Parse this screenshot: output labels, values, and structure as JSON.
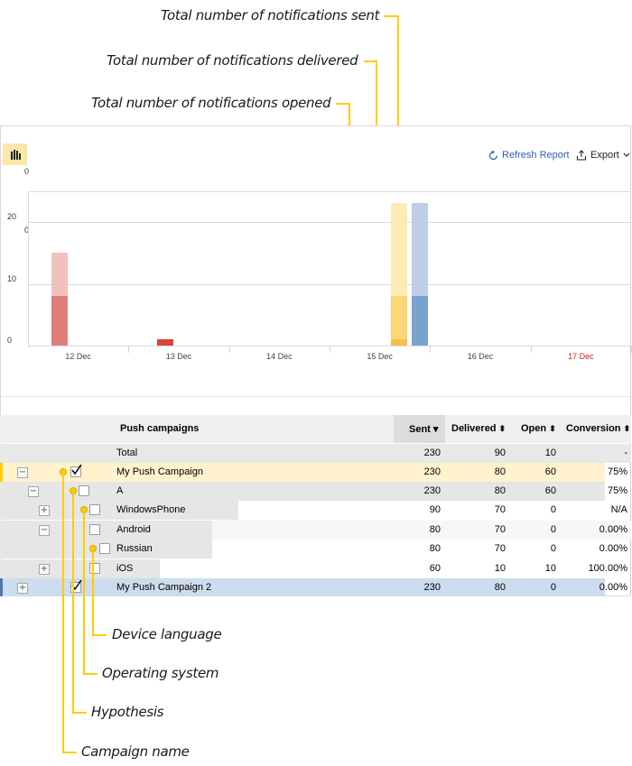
{
  "annotations": {
    "sent": "Total number of notifications sent",
    "delivered": "Total number of notifications delivered",
    "opened": "Total number of notifications opened",
    "device_language": "Device language",
    "operating_system": "Operating system",
    "hypothesis": "Hypothesis",
    "campaign_name": "Campaign name"
  },
  "toolbar": {
    "refresh_label": "Refresh Report",
    "export_label": "Export",
    "refresh_icon": "refresh-icon",
    "export_icon": "export-icon",
    "chart_toggle_icon": "column-chart-icon"
  },
  "colors": {
    "accent": "#ffcc00",
    "red_sent": "#f2c1be",
    "red_opened": "#e07f77",
    "red_small": "#d9463b",
    "yellow_sent": "#fdebb6",
    "yellow_delivered": "#fbd775",
    "yellow_opened": "#f5c043",
    "blue_sent": "#bdd0e7",
    "blue_opened": "#7aa2cf",
    "highlight_row": "#fff2cc",
    "selected_row": "#cddcee"
  },
  "chart_data": {
    "type": "bar",
    "y_ticks": [
      "0",
      "10",
      "20"
    ],
    "extra_axis_labels": [
      "0",
      "0"
    ],
    "x_ticks": [
      "12 Dec",
      "13 Dec",
      "14 Dec",
      "15 Dec",
      "16 Dec",
      "17 Dec"
    ],
    "x_ticks_weekend": [
      false,
      false,
      false,
      false,
      false,
      true
    ],
    "ylim": [
      0,
      24
    ],
    "bars": [
      {
        "date": "12 Dec",
        "color": "red",
        "sent": 15,
        "opened": 8
      },
      {
        "date": "13 Dec",
        "color": "red",
        "sent": 1,
        "opened": 1
      },
      {
        "date": "15 Dec",
        "color": "yellow",
        "sent": 23,
        "delivered": 8,
        "opened": 1
      },
      {
        "date": "15 Dec",
        "color": "blue",
        "sent": 23,
        "opened": 8
      }
    ]
  },
  "table": {
    "headers": {
      "name": "Push campaigns",
      "sent": "Sent",
      "sent_sort": "▾",
      "delivered": "Delivered",
      "open": "Open",
      "conversion": "Conversion",
      "sort_icon": "⬍"
    },
    "rows": [
      {
        "name": "Total",
        "sent": "230",
        "delivered": "90",
        "open": "10",
        "conversion": "-"
      },
      {
        "name": "My Push Campaign",
        "sent": "230",
        "delivered": "80",
        "open": "60",
        "conversion": "75%",
        "expand": "−",
        "checked": true
      },
      {
        "name": "A",
        "sent": "230",
        "delivered": "80",
        "open": "60",
        "conversion": "75%",
        "expand": "−",
        "checked": false
      },
      {
        "name": "WindowsPhone",
        "sent": "90",
        "delivered": "70",
        "open": "0",
        "conversion": "N/A",
        "expand": "+",
        "checked": false
      },
      {
        "name": "Android",
        "sent": "80",
        "delivered": "70",
        "open": "0",
        "conversion": "0.00%",
        "expand": "−",
        "checked": false
      },
      {
        "name": "Russian",
        "sent": "80",
        "delivered": "70",
        "open": "0",
        "conversion": "0.00%",
        "checked": false
      },
      {
        "name": "iOS",
        "sent": "60",
        "delivered": "10",
        "open": "10",
        "conversion": "100.00%",
        "expand": "+",
        "checked": false
      },
      {
        "name": "My Push Campaign 2",
        "sent": "230",
        "delivered": "80",
        "open": "0",
        "conversion": "0.00%",
        "expand": "+",
        "checked": true
      }
    ]
  }
}
